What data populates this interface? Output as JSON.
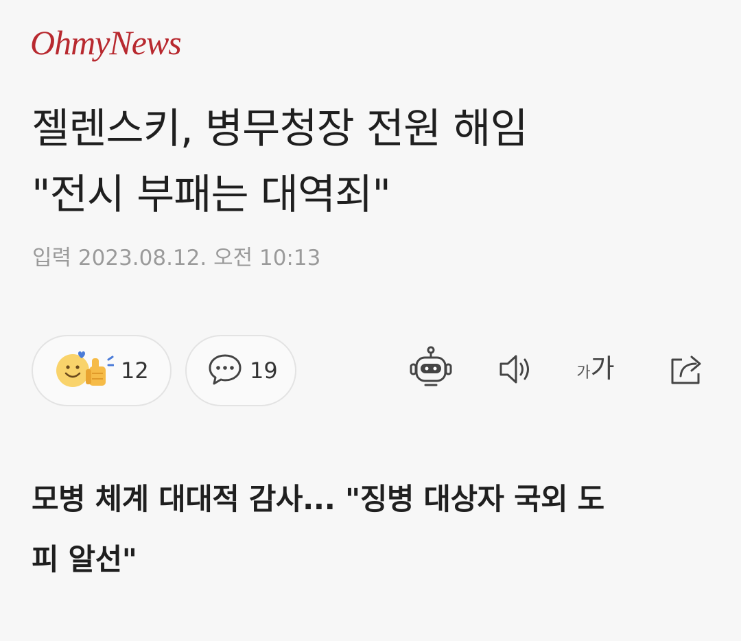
{
  "header": {
    "logo_text": "OhmyNews"
  },
  "article": {
    "headline_lines": [
      "젤렌스키, 병무청장 전원 해임",
      "\"전시 부패는 대역죄\""
    ],
    "timestamp": "입력 2023.08.12. 오전 10:13",
    "subheadline_lines": [
      "모병 체계 대대적 감사... \"징병 대상자 국외 도",
      "피 알선\""
    ]
  },
  "reactions": {
    "like_icon": "thumbs-up-smile-icon",
    "like_count": "12",
    "comment_icon": "speech-bubble-icon",
    "comment_count": "19"
  },
  "toolbar": {
    "robot_icon": "robot-icon",
    "speaker_icon": "speaker-icon",
    "font_size_small": "가",
    "font_size_large": "가",
    "share_icon": "share-icon"
  },
  "colors": {
    "brand": "#b8292f",
    "background": "#f7f7f7",
    "timestamp": "#9a9a9a"
  }
}
